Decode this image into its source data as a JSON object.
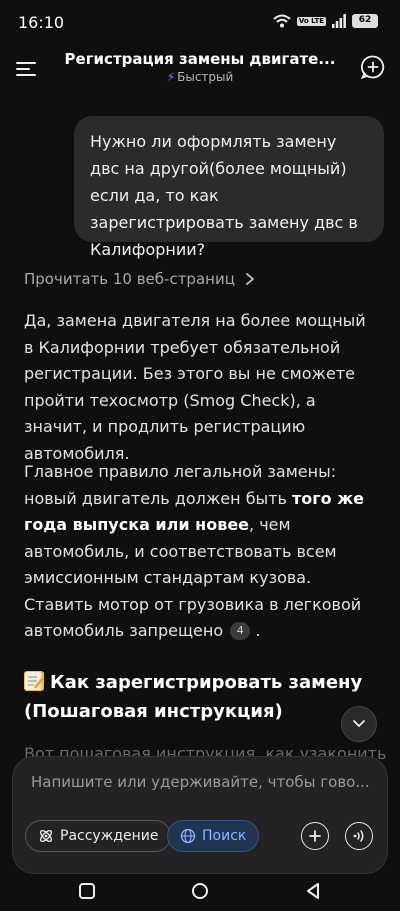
{
  "status_bar": {
    "time": "16:10",
    "network_badge": "Vo LTE",
    "battery": "62"
  },
  "header": {
    "title": "Регистрация замены двигате...",
    "mode": "Быстрый"
  },
  "user_message": "Нужно ли оформлять замену двс на другой(более мощный) если да, то как зарегистрировать замену двс в Калифорнии?",
  "sources_label": "Прочитать 10 веб-страниц",
  "answer": {
    "p1": "Да, замена двигателя на более мощный в Калифорнии требует обязательной регистрации. Без этого вы не сможете пройти техосмотр (Smog Check), а значит, и продлить регистрацию автомобиля.",
    "p2_a": "Главное правило легальной замены: новый двигатель должен быть ",
    "p2_b": "того же года выпуска или новее",
    "p2_c": ", чем автомобиль, и соответствовать всем эмиссионным стандартам кузова. Ставить мотор от грузовика в легковой автомобиль запрещено",
    "citation": "4",
    "section_heading": "Как зарегистрировать замену (Пошаговая инструкция)",
    "cut_text": "Вот пошаговая инструкция, как узаконить"
  },
  "composer": {
    "placeholder": "Напишите или удерживайте, чтобы гово...",
    "reasoning_label": "Рассуждение",
    "search_label": "Поиск"
  },
  "colors": {
    "background": "#0f0f10",
    "bubble": "#2b2b2d",
    "accent": "#5b8cff"
  }
}
